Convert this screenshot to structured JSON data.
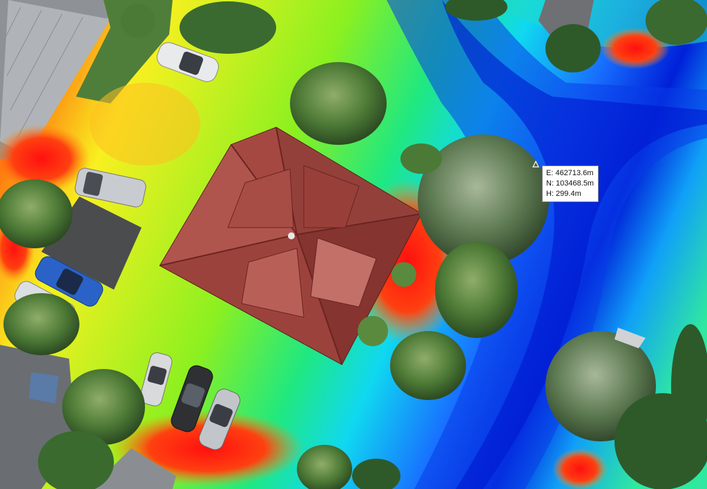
{
  "coordinate_readout": {
    "easting": "E: 462713.6m",
    "northing": "N: 103468.5m",
    "height": "H: 299.4m"
  },
  "colors": {
    "elevation_low": "#0018d8",
    "elevation_mid_low": "#00c8ff",
    "elevation_mid": "#40e860",
    "elevation_mid_high": "#f0f020",
    "elevation_high": "#ff2020",
    "roof": "#9a3f3a",
    "vegetation": "#3f6b2e"
  },
  "icons": {
    "cursor": "triangle-cursor-icon"
  }
}
